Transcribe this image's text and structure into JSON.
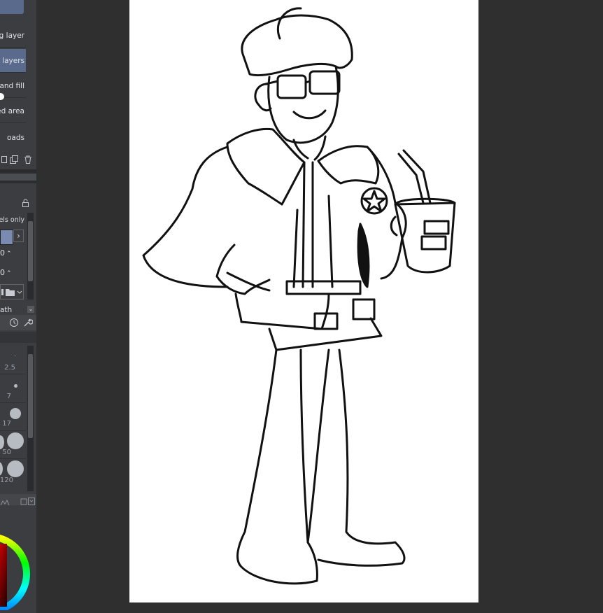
{
  "layer_menu": {
    "items": [
      {
        "label": "ng layer",
        "highlighted": false
      },
      {
        "label": "er layers",
        "highlighted": true
      },
      {
        "label": "e and fill",
        "highlighted": false
      },
      {
        "label": "ed area",
        "highlighted": false
      },
      {
        "label": "oads",
        "highlighted": false
      }
    ]
  },
  "tool_property": {
    "pixels_only_label": "ixels only",
    "value_1": "0",
    "value_2": "0",
    "path_label": "ath"
  },
  "brush_sizes": [
    "2.5",
    "7",
    "17",
    "50",
    "120"
  ],
  "icons": {
    "layer_tools": [
      "new-layer-icon",
      "duplicate-layer-icon",
      "delete-layer-icon"
    ],
    "lock": "lock-icon",
    "settings": [
      "timer-icon",
      "wrench-icon"
    ]
  },
  "colors": {
    "panel_bg": "#3b3d40",
    "highlight": "#5a6a8c",
    "canvas_bg": "#2f2f2f",
    "paper": "#ffffff",
    "current_color": "#cc0000"
  }
}
